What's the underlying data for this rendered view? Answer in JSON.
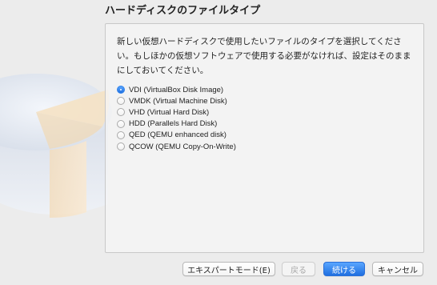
{
  "dialog": {
    "title": "ハードディスクのファイルタイプ",
    "description": "新しい仮想ハードディスクで使用したいファイルのタイプを選択してください。もしほかの仮想ソフトウェアで使用する必要がなければ、設定はそのままにしておいてください。"
  },
  "options": [
    {
      "label": "VDI (VirtualBox Disk Image)",
      "selected": true
    },
    {
      "label": "VMDK (Virtual Machine Disk)",
      "selected": false
    },
    {
      "label": "VHD (Virtual Hard Disk)",
      "selected": false
    },
    {
      "label": "HDD (Parallels Hard Disk)",
      "selected": false
    },
    {
      "label": "QED (QEMU enhanced disk)",
      "selected": false
    },
    {
      "label": "QCOW (QEMU Copy-On-Write)",
      "selected": false
    }
  ],
  "buttons": {
    "expert": "エキスパートモード(E)",
    "back": "戻る",
    "continue": "続ける",
    "cancel": "キャンセル"
  },
  "colors": {
    "accent": "#1f6fe0",
    "background": "#ececec"
  }
}
